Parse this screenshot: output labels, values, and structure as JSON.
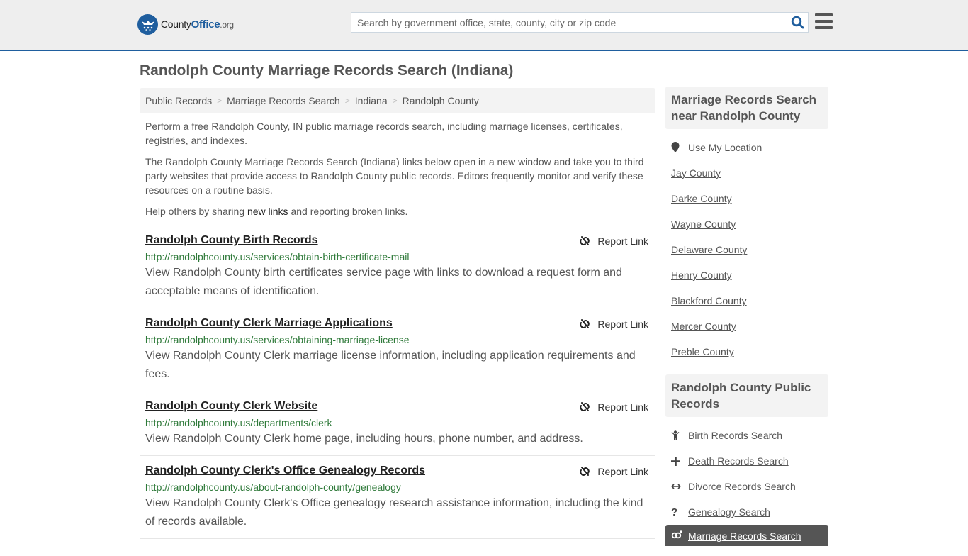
{
  "header": {
    "logo": {
      "county": "County",
      "office": "Office",
      "org": ".org"
    },
    "search_placeholder": "Search by government office, state, county, city or zip code"
  },
  "page_title": "Randolph County Marriage Records Search (Indiana)",
  "breadcrumb": [
    "Public Records",
    "Marriage Records Search",
    "Indiana",
    "Randolph County"
  ],
  "intro": {
    "p1": "Perform a free Randolph County, IN public marriage records search, including marriage licenses, certificates, registries, and indexes.",
    "p2": "The Randolph County Marriage Records Search (Indiana) links below open in a new window and take you to third party websites that provide access to Randolph County public records. Editors frequently monitor and verify these resources on a routine basis.",
    "p3_before": "Help others by sharing ",
    "p3_link": "new links",
    "p3_after": " and reporting broken links."
  },
  "report_label": "Report Link",
  "results": [
    {
      "title": "Randolph County Birth Records",
      "url": "http://randolphcounty.us/services/obtain-birth-certificate-mail",
      "desc": "View Randolph County birth certificates service page with links to download a request form and acceptable means of identification."
    },
    {
      "title": "Randolph County Clerk Marriage Applications",
      "url": "http://randolphcounty.us/services/obtaining-marriage-license",
      "desc": "View Randolph County Clerk marriage license information, including application requirements and fees."
    },
    {
      "title": "Randolph County Clerk Website",
      "url": "http://randolphcounty.us/departments/clerk",
      "desc": "View Randolph County Clerk home page, including hours, phone number, and address."
    },
    {
      "title": "Randolph County Clerk's Office Genealogy Records",
      "url": "http://randolphcounty.us/about-randolph-county/genealogy",
      "desc": "View Randolph County Clerk's Office genealogy research assistance information, including the kind of records available."
    }
  ],
  "sidebar": {
    "nearby_heading": "Marriage Records Search near Randolph County",
    "use_location": "Use My Location",
    "nearby": [
      "Jay County",
      "Darke County",
      "Wayne County",
      "Delaware County",
      "Henry County",
      "Blackford County",
      "Mercer County",
      "Preble County"
    ],
    "public_heading": "Randolph County Public Records",
    "public_items": [
      {
        "label": "Birth Records Search",
        "icon": "child-icon"
      },
      {
        "label": "Death Records Search",
        "icon": "plus-icon"
      },
      {
        "label": "Divorce Records Search",
        "icon": "arrows-horizontal-icon"
      },
      {
        "label": "Genealogy Search",
        "icon": "question-icon"
      },
      {
        "label": "Marriage Records Search",
        "icon": "venus-mars-icon",
        "active": true
      }
    ]
  }
}
